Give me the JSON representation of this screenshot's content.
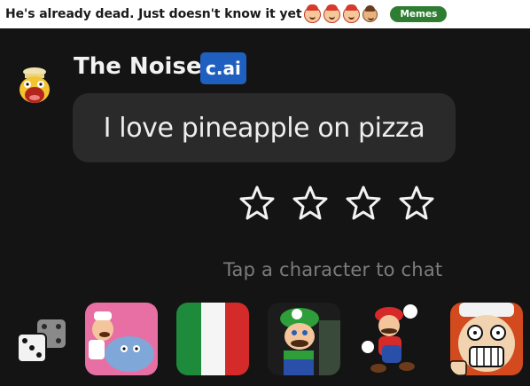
{
  "post": {
    "title": "He's already dead. Just doesn't know it yet",
    "flair": "Memes",
    "emojis": [
      "santa-emoji",
      "santa-emoji",
      "santa-emoji",
      "face-emoji"
    ]
  },
  "chat": {
    "character_name": "The Noise",
    "badge": "c.ai",
    "message": "I love pineapple on pizza",
    "rating_stars": 4,
    "rating_value": 0,
    "hint": "Tap a character to chat"
  },
  "characters": [
    {
      "icon": "random-dice-icon"
    },
    {
      "name": "pizza-chef-avatar"
    },
    {
      "name": "italy-flag-avatar"
    },
    {
      "name": "luigi-avatar"
    },
    {
      "name": "mario-avatar"
    },
    {
      "name": "screaming-chef-avatar"
    }
  ],
  "colors": {
    "background": "#141414",
    "bubble": "#2a2a2b",
    "badge": "#1f5fbf",
    "flair": "#2e7d32",
    "hint": "#7c7c7c"
  }
}
